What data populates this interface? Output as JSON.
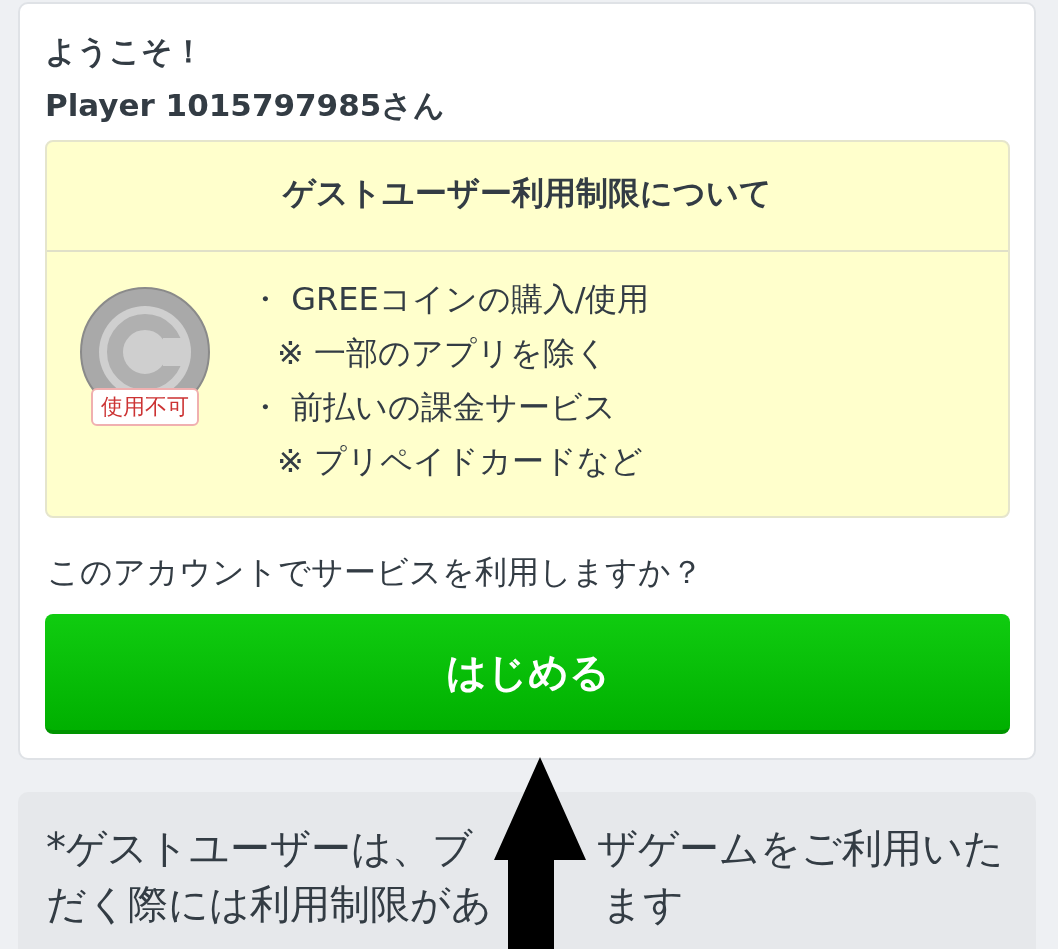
{
  "welcome": {
    "greeting": "ようこそ！",
    "user": "Player 1015797985さん"
  },
  "restriction": {
    "title": "ゲストユーザー利用制限について",
    "badge": "使用不可",
    "items": [
      {
        "kind": "bullet",
        "mark": "・",
        "text": "GREEコインの購入/使用"
      },
      {
        "kind": "note",
        "mark": "※",
        "text": "一部のアプリを除く"
      },
      {
        "kind": "bullet",
        "mark": "・",
        "text": "前払いの課金サービス"
      },
      {
        "kind": "note",
        "mark": "※",
        "text": "プリペイドカードなど"
      }
    ]
  },
  "question": "このアカウントでサービスを利用しますか？",
  "start_button": "はじめる",
  "notice": {
    "lines": [
      [
        "*ゲストユーザーは、ブ",
        "ザゲームをご利用いた"
      ],
      [
        "だく際には利用制限があ",
        "ます"
      ]
    ]
  }
}
